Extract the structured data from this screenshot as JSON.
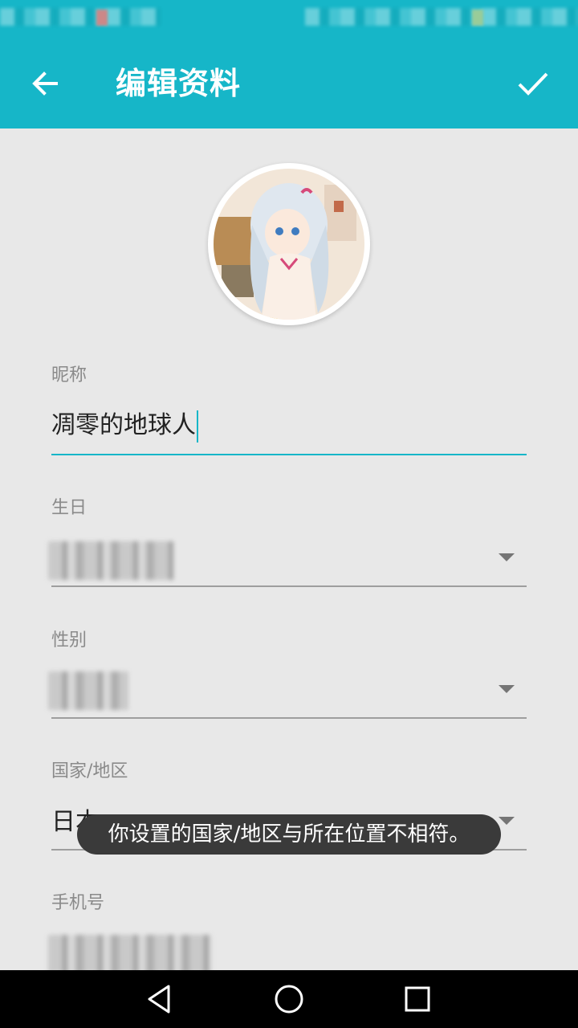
{
  "toolbar": {
    "title": "编辑资料",
    "back_icon": "arrow-left-icon",
    "confirm_icon": "check-icon",
    "accent_color": "#16b6c8"
  },
  "avatar": {
    "icon": "anime-avatar-image"
  },
  "fields": {
    "nickname": {
      "label": "昵称",
      "value": "凋零的地球人"
    },
    "birthday": {
      "label": "生日"
    },
    "gender": {
      "label": "性别"
    },
    "country": {
      "label": "国家/地区",
      "value": "日本"
    },
    "phone": {
      "label": "手机号"
    }
  },
  "toast": {
    "message": "你设置的国家/地区与所在位置不相符。"
  },
  "nav": {
    "back_icon": "triangle-back-icon",
    "home_icon": "circle-home-icon",
    "recents_icon": "square-recents-icon"
  }
}
